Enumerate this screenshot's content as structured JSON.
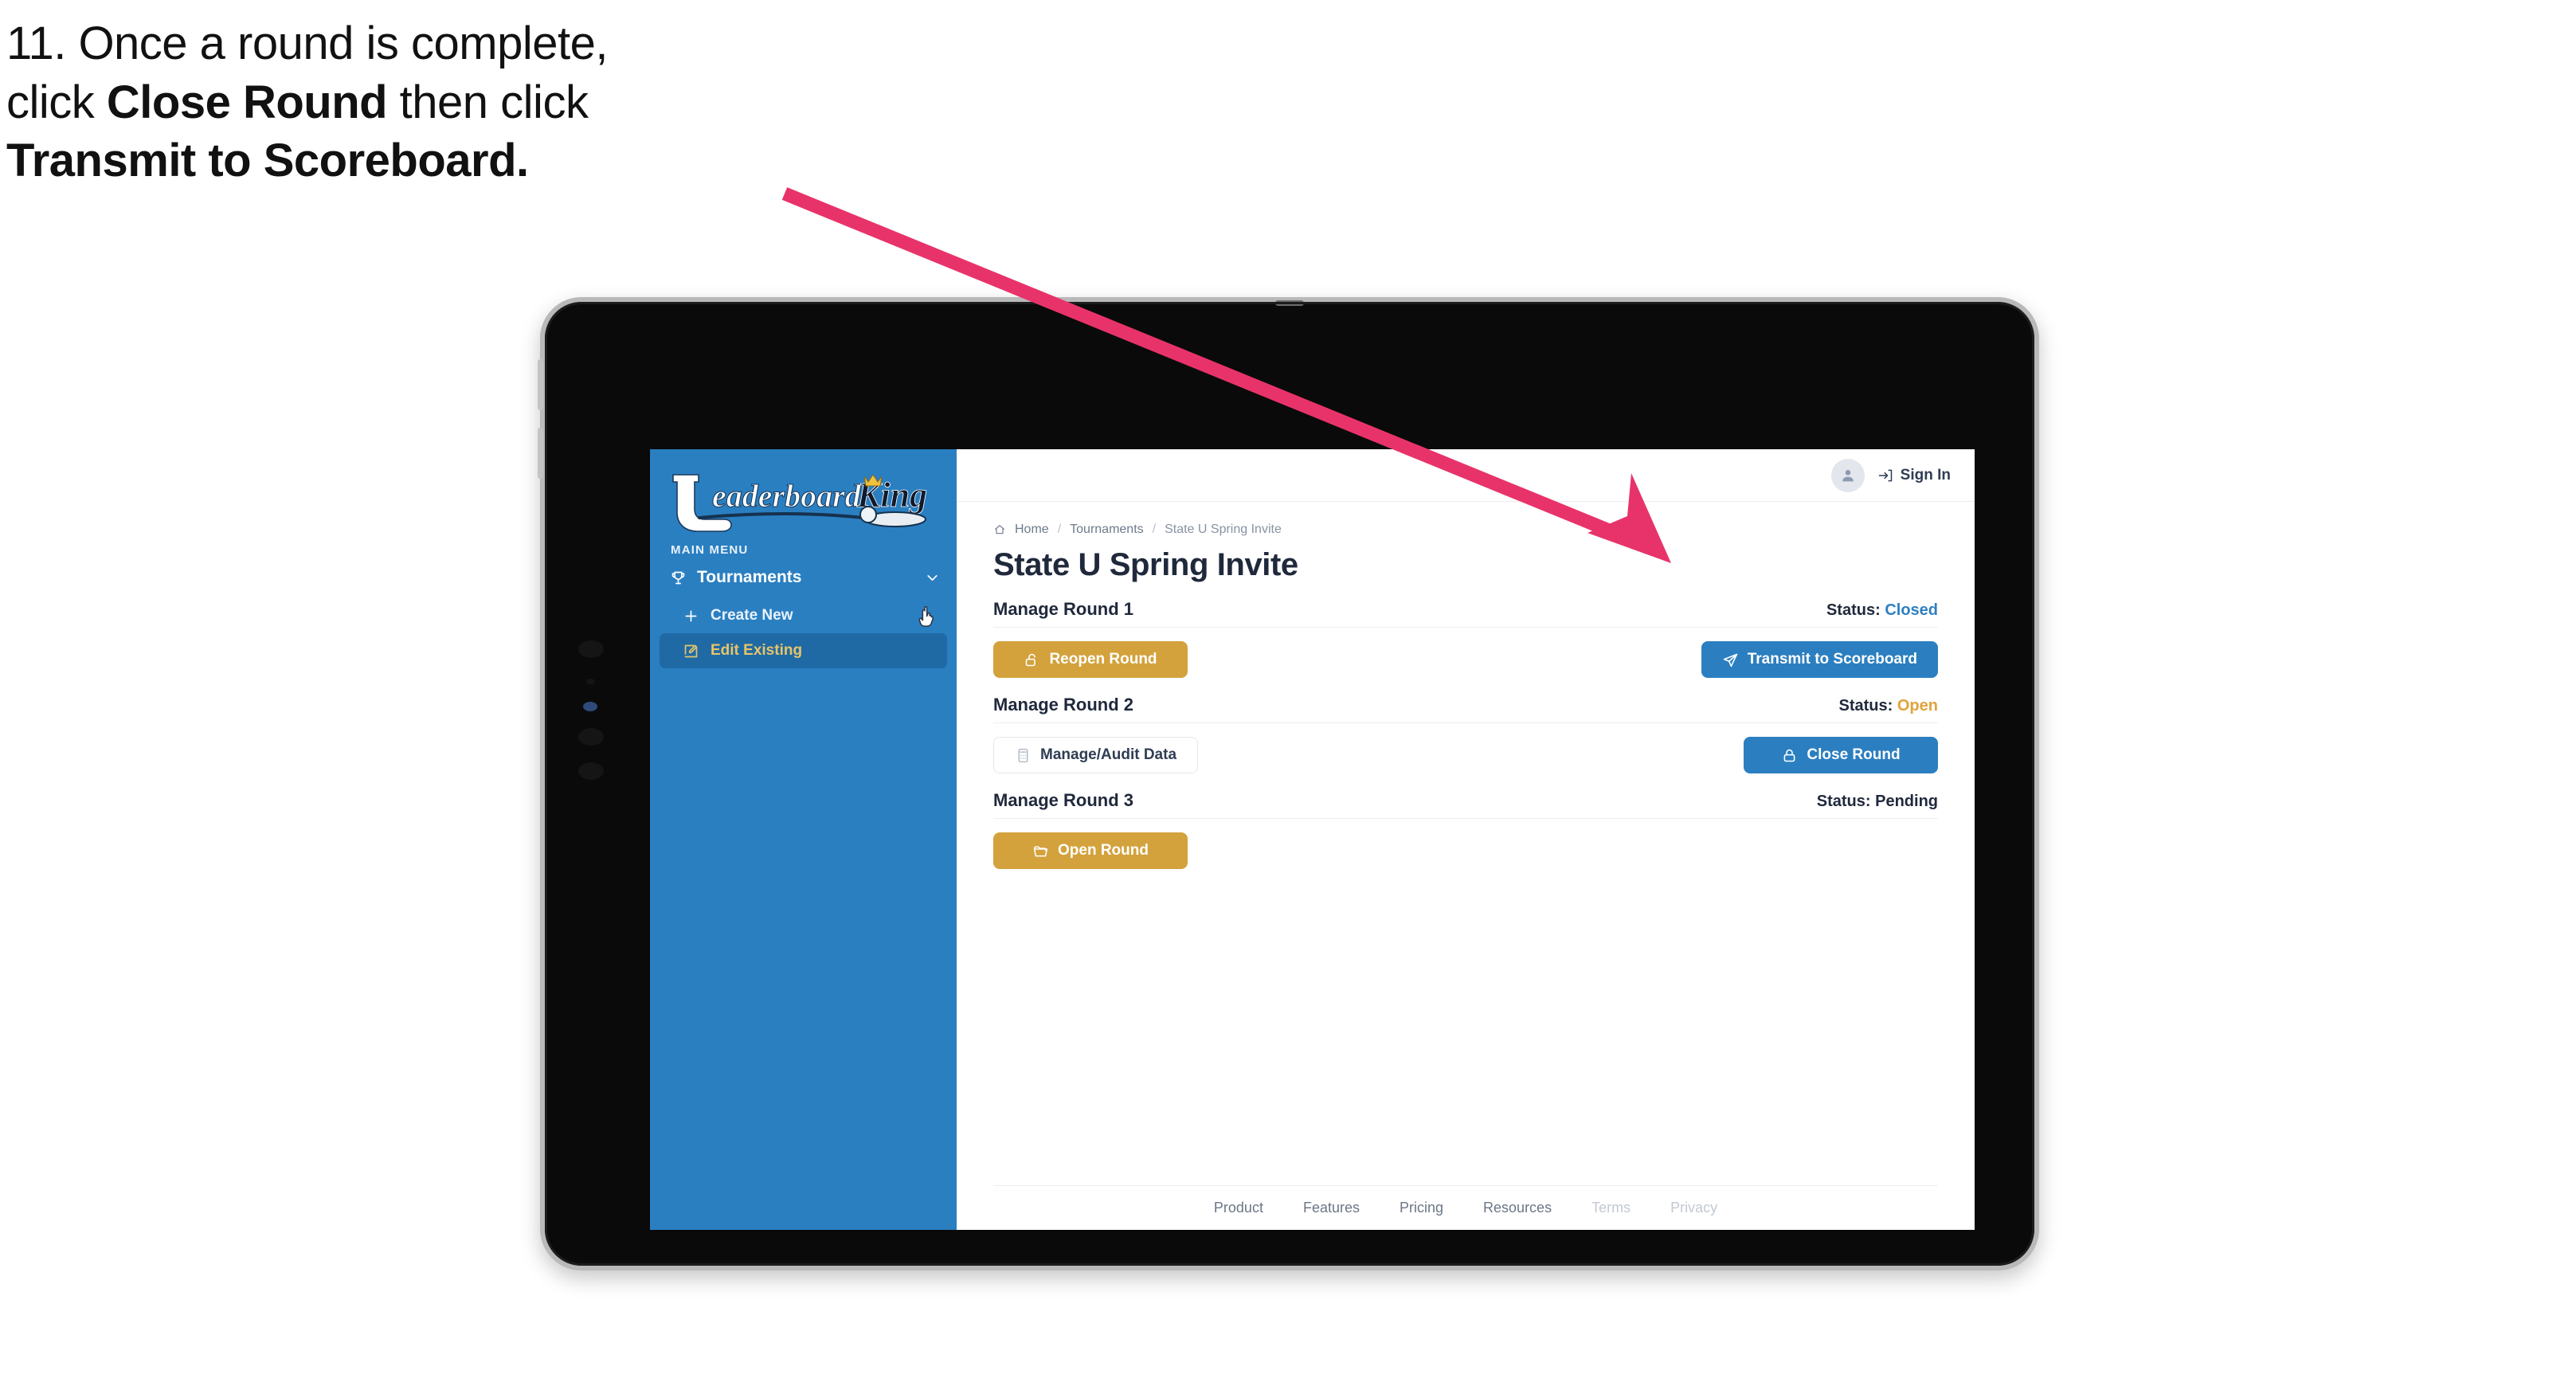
{
  "caption": {
    "line1": "11. Once a round is complete,",
    "line2_pre": "click ",
    "line2_bold": "Close Round",
    "line2_post": " then click",
    "line3_bold": "Transmit to Scoreboard."
  },
  "annotation": {
    "arrow_color": "#e8336a",
    "points_to": "transmit-to-scoreboard-button"
  },
  "sidebar": {
    "logo": {
      "word1": "Leaderboard",
      "word2": "King",
      "icon": "golf-club-logo"
    },
    "section_label": "MAIN MENU",
    "nav": [
      {
        "label": "Tournaments",
        "icon": "trophy-icon",
        "chevron": "chevron-down-icon",
        "expanded": true
      }
    ],
    "sub_items": [
      {
        "label": "Create New",
        "icon": "plus-icon",
        "active": false
      },
      {
        "label": "Edit Existing",
        "icon": "edit-square-icon",
        "active": true
      }
    ],
    "bg_color": "#2a7fc1",
    "active_bg_color": "#1f6aa5",
    "active_text_color": "#e7c46a"
  },
  "topbar": {
    "avatar_icon": "user-avatar-icon",
    "signin_icon": "sign-in-arrow-icon",
    "signin_label": "Sign In"
  },
  "breadcrumb": {
    "home_icon": "home-icon",
    "items": [
      "Home",
      "Tournaments",
      "State U Spring Invite"
    ],
    "separator": "/"
  },
  "page": {
    "title": "State U Spring Invite"
  },
  "rounds": [
    {
      "name": "Manage Round 1",
      "status_label": "Status:",
      "status_value": "Closed",
      "status_kind": "closed",
      "left_button": {
        "label": "Reopen Round",
        "icon": "unlock-icon",
        "style": "gold"
      },
      "right_button": {
        "label": "Transmit to Scoreboard",
        "icon": "send-plane-icon",
        "style": "blue"
      }
    },
    {
      "name": "Manage Round 2",
      "status_label": "Status:",
      "status_value": "Open",
      "status_kind": "open",
      "left_button": {
        "label": "Manage/Audit Data",
        "icon": "calculator-icon",
        "style": "ghost"
      },
      "right_button": {
        "label": "Close Round",
        "icon": "lock-icon",
        "style": "blue"
      }
    },
    {
      "name": "Manage Round 3",
      "status_label": "Status:",
      "status_value": "Pending",
      "status_kind": "pending",
      "left_button": {
        "label": "Open Round",
        "icon": "folder-open-icon",
        "style": "gold"
      },
      "right_button": null
    }
  ],
  "footer": {
    "links": [
      {
        "label": "Product",
        "muted": false
      },
      {
        "label": "Features",
        "muted": false
      },
      {
        "label": "Pricing",
        "muted": false
      },
      {
        "label": "Resources",
        "muted": false
      },
      {
        "label": "Terms",
        "muted": true
      },
      {
        "label": "Privacy",
        "muted": true
      }
    ]
  },
  "colors": {
    "brand_blue": "#2a7fc1",
    "brand_gold": "#d3a23c",
    "status_open": "#e0a33b",
    "status_closed": "#2f7fc0",
    "text_dark": "#20293c"
  }
}
